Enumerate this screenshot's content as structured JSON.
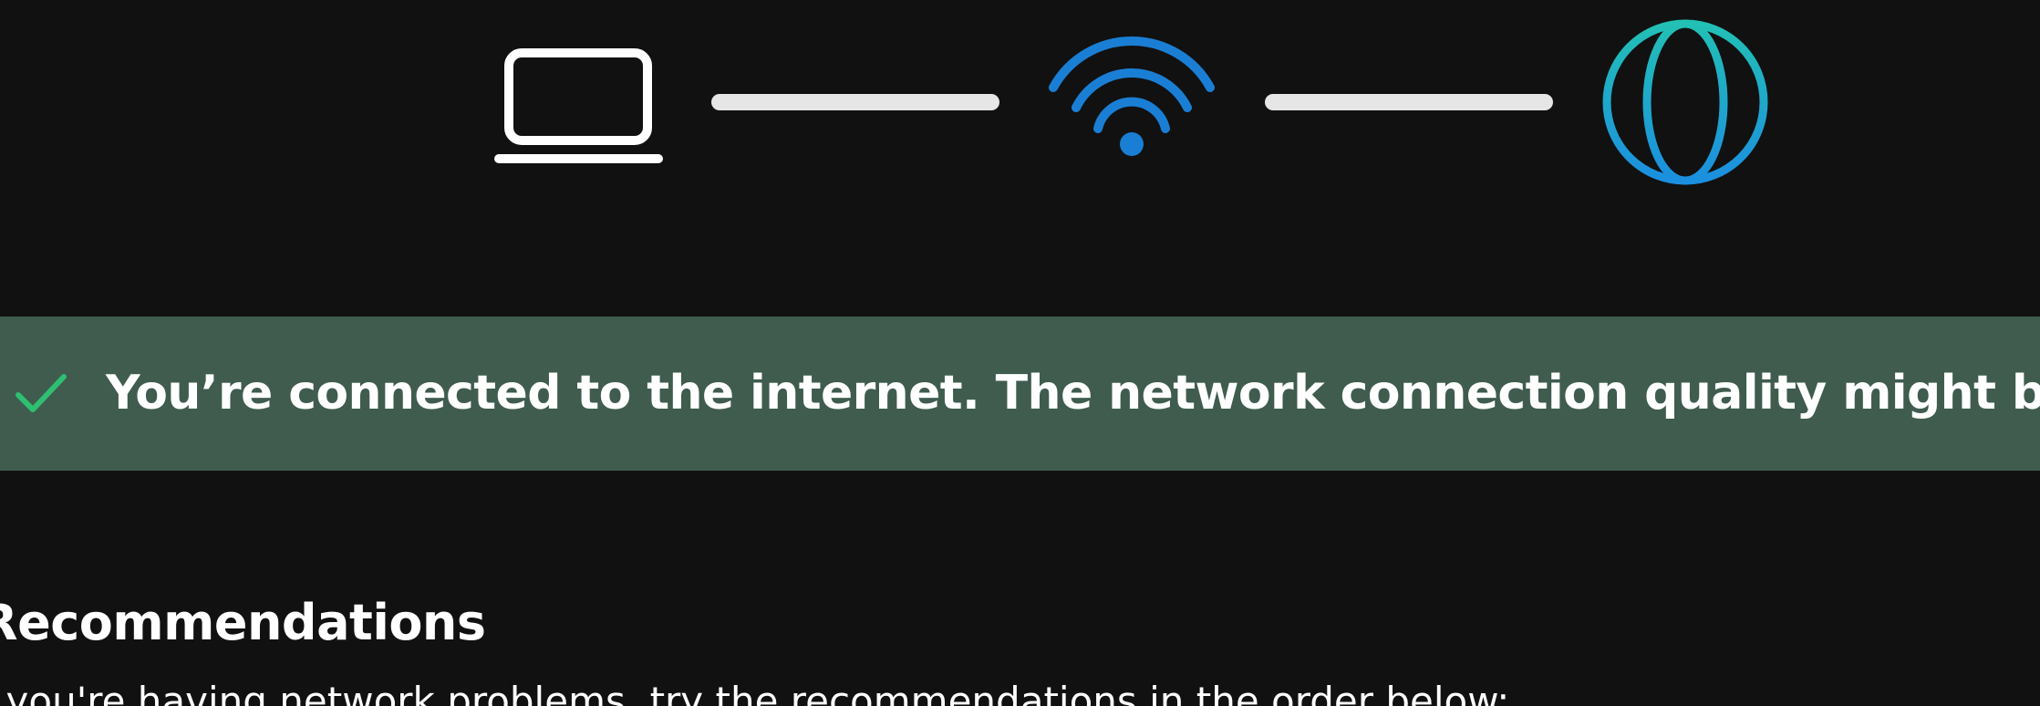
{
  "diagram": {
    "device_icon": "laptop-icon",
    "router_icon": "wifi-icon",
    "internet_icon": "globe-icon",
    "colors": {
      "connector": "#e6e6e6",
      "wifi": "#1a7fd4",
      "globe_top": "#22c0b5",
      "globe_bottom": "#1b8fe0"
    }
  },
  "status": {
    "icon": "checkmark-icon",
    "message": "You’re connected to the internet. The network connection quality might be low.",
    "background": "#3f5c4f",
    "check_color": "#2fbf71"
  },
  "recommendations": {
    "heading": "Recommendations",
    "intro": "If you're having network problems, try the recommendations in the order below:"
  }
}
